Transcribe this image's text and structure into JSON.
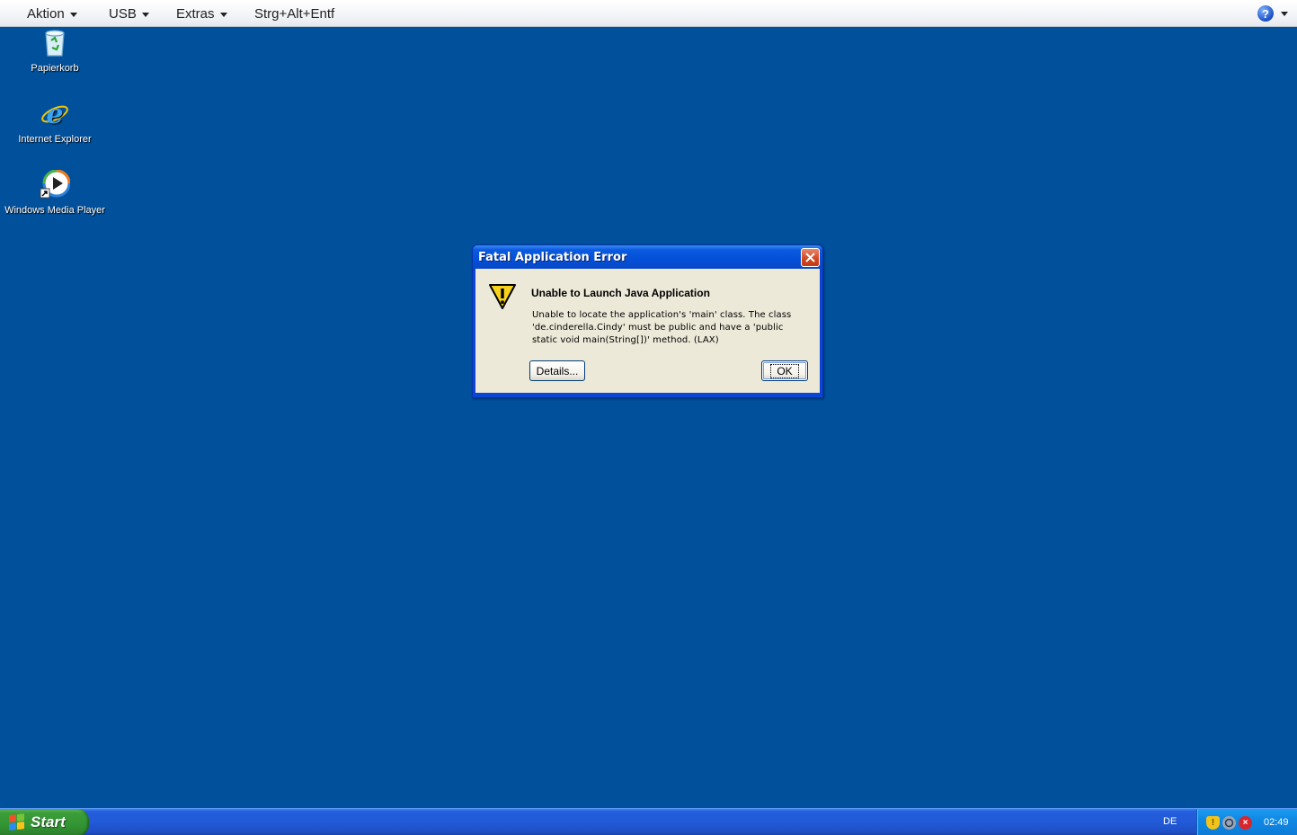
{
  "menubar": {
    "items": [
      {
        "label": "Aktion"
      },
      {
        "label": "USB"
      },
      {
        "label": "Extras"
      },
      {
        "label": "Strg+Alt+Entf"
      }
    ],
    "help_icon": "help-icon"
  },
  "desktop": {
    "icons": [
      {
        "label": "Papierkorb",
        "icon": "recycle-bin-icon"
      },
      {
        "label": "Internet Explorer",
        "icon": "internet-explorer-icon"
      },
      {
        "label": "Windows Media Player",
        "icon": "windows-media-player-icon"
      }
    ]
  },
  "dialog": {
    "title": "Fatal Application Error",
    "heading": "Unable to Launch Java Application",
    "message": "Unable to locate the application's 'main' class. The class 'de.cinderella.Cindy' must be public and have a 'public static void main(String[])' method. (LAX)",
    "details_label": "Details...",
    "ok_label": "OK",
    "icon": "warning-icon"
  },
  "taskbar": {
    "start_label": "Start",
    "language": "DE",
    "clock": "02:49",
    "tray_icons": [
      "security-shield-icon",
      "network-icon",
      "security-alert-icon"
    ]
  },
  "colors": {
    "desktop": "#00509c",
    "taskbar": "#245edc",
    "start_button": "#3b9e39",
    "dialog_title": "#0a5ae0",
    "dialog_body": "#ece9d8"
  }
}
